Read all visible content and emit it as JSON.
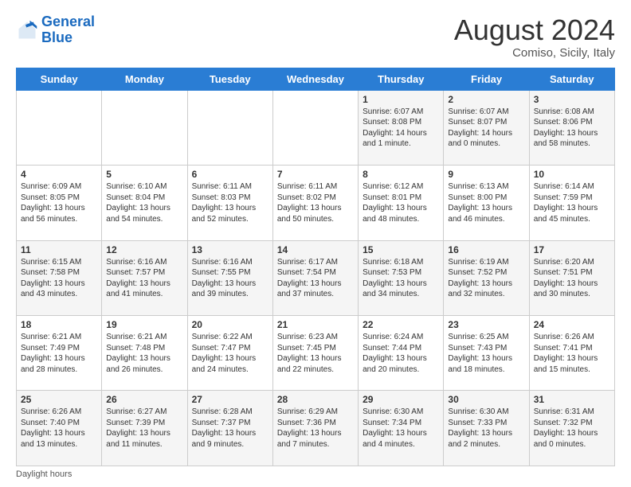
{
  "logo": {
    "line1": "General",
    "line2": "Blue"
  },
  "header": {
    "month_year": "August 2024",
    "location": "Comiso, Sicily, Italy"
  },
  "days_of_week": [
    "Sunday",
    "Monday",
    "Tuesday",
    "Wednesday",
    "Thursday",
    "Friday",
    "Saturday"
  ],
  "footer_label": "Daylight hours",
  "weeks": [
    [
      {
        "day": "",
        "info": ""
      },
      {
        "day": "",
        "info": ""
      },
      {
        "day": "",
        "info": ""
      },
      {
        "day": "",
        "info": ""
      },
      {
        "day": "1",
        "info": "Sunrise: 6:07 AM\nSunset: 8:08 PM\nDaylight: 14 hours\nand 1 minute."
      },
      {
        "day": "2",
        "info": "Sunrise: 6:07 AM\nSunset: 8:07 PM\nDaylight: 14 hours\nand 0 minutes."
      },
      {
        "day": "3",
        "info": "Sunrise: 6:08 AM\nSunset: 8:06 PM\nDaylight: 13 hours\nand 58 minutes."
      }
    ],
    [
      {
        "day": "4",
        "info": "Sunrise: 6:09 AM\nSunset: 8:05 PM\nDaylight: 13 hours\nand 56 minutes."
      },
      {
        "day": "5",
        "info": "Sunrise: 6:10 AM\nSunset: 8:04 PM\nDaylight: 13 hours\nand 54 minutes."
      },
      {
        "day": "6",
        "info": "Sunrise: 6:11 AM\nSunset: 8:03 PM\nDaylight: 13 hours\nand 52 minutes."
      },
      {
        "day": "7",
        "info": "Sunrise: 6:11 AM\nSunset: 8:02 PM\nDaylight: 13 hours\nand 50 minutes."
      },
      {
        "day": "8",
        "info": "Sunrise: 6:12 AM\nSunset: 8:01 PM\nDaylight: 13 hours\nand 48 minutes."
      },
      {
        "day": "9",
        "info": "Sunrise: 6:13 AM\nSunset: 8:00 PM\nDaylight: 13 hours\nand 46 minutes."
      },
      {
        "day": "10",
        "info": "Sunrise: 6:14 AM\nSunset: 7:59 PM\nDaylight: 13 hours\nand 45 minutes."
      }
    ],
    [
      {
        "day": "11",
        "info": "Sunrise: 6:15 AM\nSunset: 7:58 PM\nDaylight: 13 hours\nand 43 minutes."
      },
      {
        "day": "12",
        "info": "Sunrise: 6:16 AM\nSunset: 7:57 PM\nDaylight: 13 hours\nand 41 minutes."
      },
      {
        "day": "13",
        "info": "Sunrise: 6:16 AM\nSunset: 7:55 PM\nDaylight: 13 hours\nand 39 minutes."
      },
      {
        "day": "14",
        "info": "Sunrise: 6:17 AM\nSunset: 7:54 PM\nDaylight: 13 hours\nand 37 minutes."
      },
      {
        "day": "15",
        "info": "Sunrise: 6:18 AM\nSunset: 7:53 PM\nDaylight: 13 hours\nand 34 minutes."
      },
      {
        "day": "16",
        "info": "Sunrise: 6:19 AM\nSunset: 7:52 PM\nDaylight: 13 hours\nand 32 minutes."
      },
      {
        "day": "17",
        "info": "Sunrise: 6:20 AM\nSunset: 7:51 PM\nDaylight: 13 hours\nand 30 minutes."
      }
    ],
    [
      {
        "day": "18",
        "info": "Sunrise: 6:21 AM\nSunset: 7:49 PM\nDaylight: 13 hours\nand 28 minutes."
      },
      {
        "day": "19",
        "info": "Sunrise: 6:21 AM\nSunset: 7:48 PM\nDaylight: 13 hours\nand 26 minutes."
      },
      {
        "day": "20",
        "info": "Sunrise: 6:22 AM\nSunset: 7:47 PM\nDaylight: 13 hours\nand 24 minutes."
      },
      {
        "day": "21",
        "info": "Sunrise: 6:23 AM\nSunset: 7:45 PM\nDaylight: 13 hours\nand 22 minutes."
      },
      {
        "day": "22",
        "info": "Sunrise: 6:24 AM\nSunset: 7:44 PM\nDaylight: 13 hours\nand 20 minutes."
      },
      {
        "day": "23",
        "info": "Sunrise: 6:25 AM\nSunset: 7:43 PM\nDaylight: 13 hours\nand 18 minutes."
      },
      {
        "day": "24",
        "info": "Sunrise: 6:26 AM\nSunset: 7:41 PM\nDaylight: 13 hours\nand 15 minutes."
      }
    ],
    [
      {
        "day": "25",
        "info": "Sunrise: 6:26 AM\nSunset: 7:40 PM\nDaylight: 13 hours\nand 13 minutes."
      },
      {
        "day": "26",
        "info": "Sunrise: 6:27 AM\nSunset: 7:39 PM\nDaylight: 13 hours\nand 11 minutes."
      },
      {
        "day": "27",
        "info": "Sunrise: 6:28 AM\nSunset: 7:37 PM\nDaylight: 13 hours\nand 9 minutes."
      },
      {
        "day": "28",
        "info": "Sunrise: 6:29 AM\nSunset: 7:36 PM\nDaylight: 13 hours\nand 7 minutes."
      },
      {
        "day": "29",
        "info": "Sunrise: 6:30 AM\nSunset: 7:34 PM\nDaylight: 13 hours\nand 4 minutes."
      },
      {
        "day": "30",
        "info": "Sunrise: 6:30 AM\nSunset: 7:33 PM\nDaylight: 13 hours\nand 2 minutes."
      },
      {
        "day": "31",
        "info": "Sunrise: 6:31 AM\nSunset: 7:32 PM\nDaylight: 13 hours\nand 0 minutes."
      }
    ]
  ]
}
